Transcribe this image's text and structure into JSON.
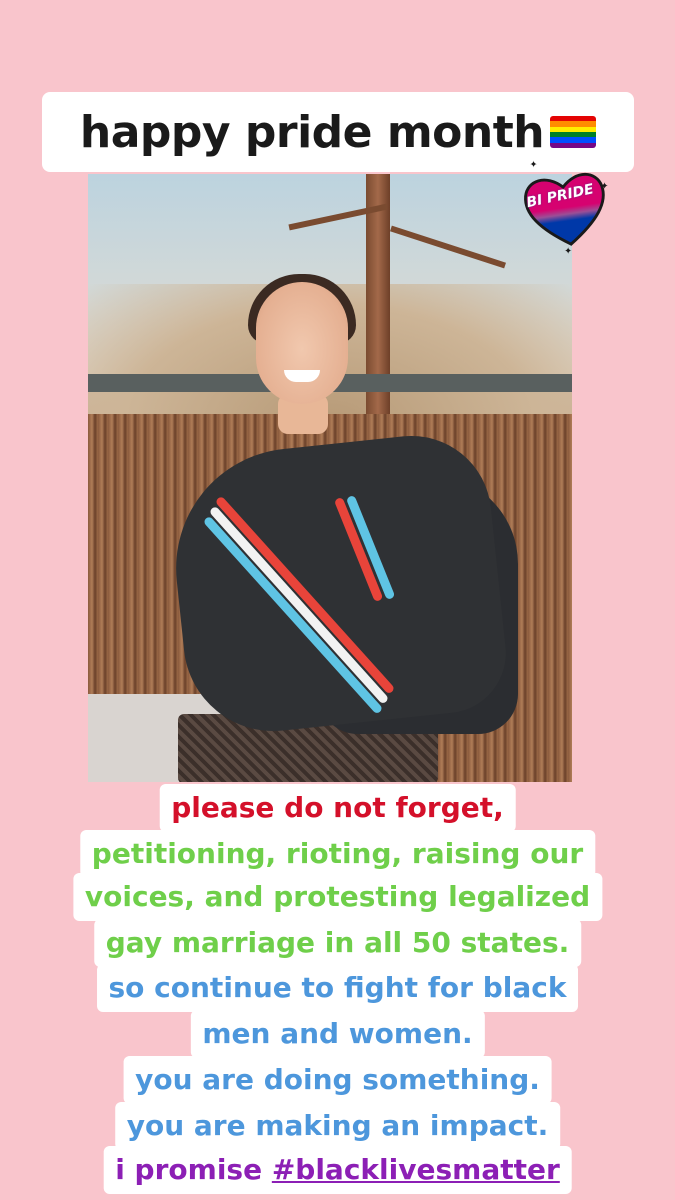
{
  "title": "happy pride month",
  "pride_flag_colors": [
    "#e40303",
    "#ff8c00",
    "#ffed00",
    "#008026",
    "#004dff",
    "#750787"
  ],
  "bi_sticker": {
    "text": "BI PRIDE",
    "colors": [
      "#d60270",
      "#9b4f96",
      "#0038a8"
    ]
  },
  "message": {
    "line1": "please do not forget,",
    "line2": "petitioning, rioting, raising our",
    "line3": "voices, and protesting legalized",
    "line4": "gay marriage in all 50 states.",
    "line5": "so continue to fight for black",
    "line6": "men and women.",
    "line7": "you are doing something.",
    "line8": "you are making an impact.",
    "line9_prefix": "i promise ",
    "line9_hashtag": "#blacklivesmatter"
  },
  "colors": {
    "background": "#f9c5cc",
    "red_text": "#d4102a",
    "green_text": "#6fcf4a",
    "blue_text": "#4d97dc",
    "purple_text": "#8c1fb5"
  }
}
